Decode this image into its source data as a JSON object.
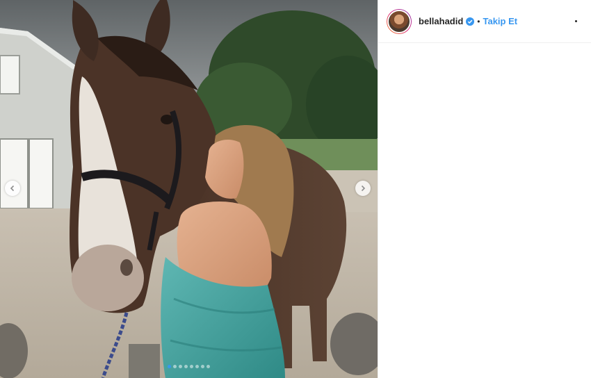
{
  "post": {
    "username": "bellahadid",
    "follow_label": "Takip Et",
    "separator": "•",
    "verified": true,
    "accent_color": "#3897f0",
    "icons": {
      "prev": "chevron-left-icon",
      "next": "chevron-right-icon",
      "verified": "verified-badge-icon",
      "more": "more-options-icon"
    },
    "carousel": {
      "count": 8,
      "active_index": 0
    }
  }
}
